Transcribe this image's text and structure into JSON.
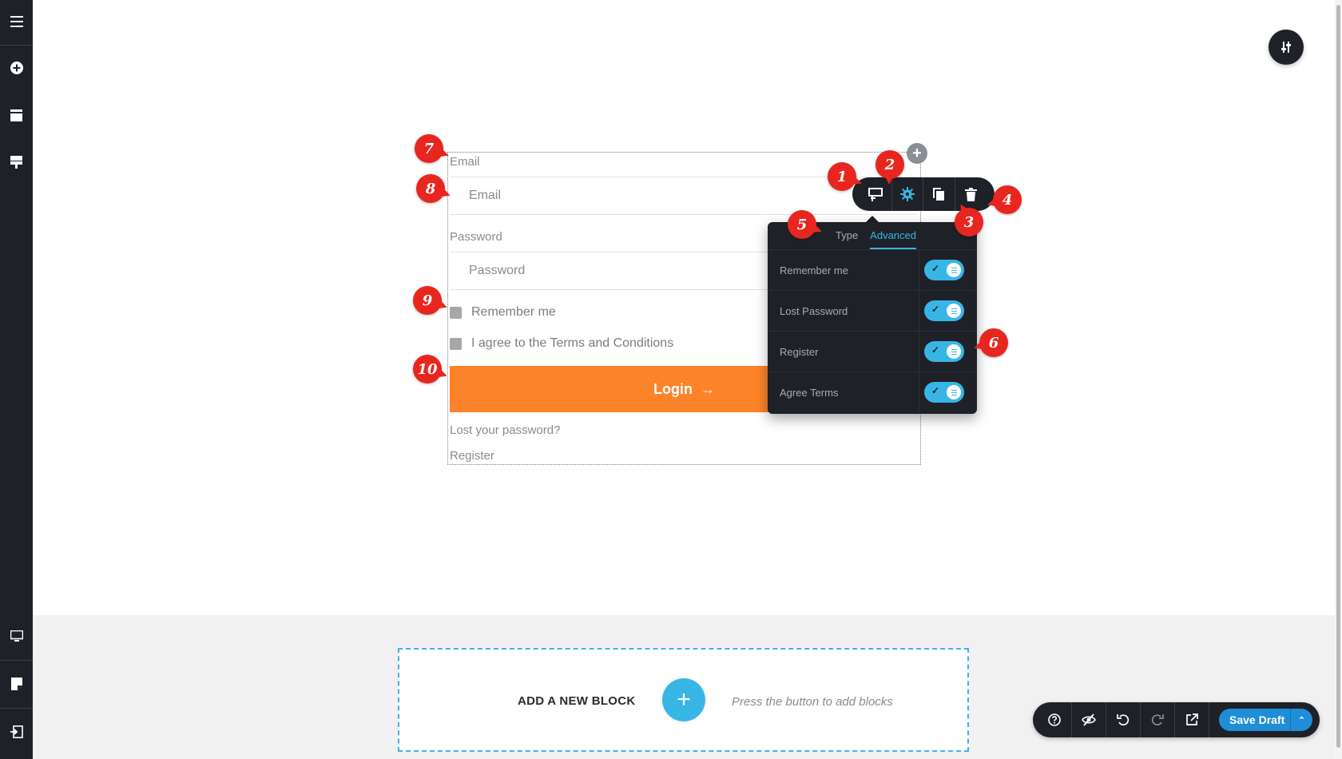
{
  "sidebar": {
    "top_icons": [
      "menu-icon",
      "add-circle-icon",
      "layout-icon",
      "blocks-icon"
    ],
    "bottom_icons": [
      "desktop-icon",
      "page-icon",
      "exit-icon"
    ]
  },
  "form": {
    "email_label": "Email",
    "email_placeholder": "Email",
    "password_label": "Password",
    "password_placeholder": "Password",
    "remember_label": "Remember me",
    "terms_label": "I agree to the Terms and Conditions",
    "login_label": "Login",
    "login_arrow": "→",
    "lost_password": "Lost your password?",
    "register": "Register"
  },
  "toolbar": {
    "buttons": [
      "layout-icon",
      "gear-icon",
      "copy-icon",
      "trash-icon"
    ],
    "add_label": "+"
  },
  "panel": {
    "tabs": [
      {
        "label": "Type",
        "active": false
      },
      {
        "label": "Advanced",
        "active": true
      }
    ],
    "rows": [
      {
        "label": "Remember me",
        "enabled": true
      },
      {
        "label": "Lost Password",
        "enabled": true
      },
      {
        "label": "Register",
        "enabled": true
      },
      {
        "label": "Agree Terms",
        "enabled": true
      }
    ]
  },
  "markers": [
    "1",
    "2",
    "3",
    "4",
    "5",
    "6",
    "7",
    "8",
    "9",
    "10"
  ],
  "add_block": {
    "title": "ADD A NEW BLOCK",
    "plus": "+",
    "hint": "Press the button to add blocks"
  },
  "actionbar": {
    "icons": [
      "help-icon",
      "hide-icon",
      "undo-icon",
      "redo-icon",
      "external-link-icon"
    ],
    "save_label": "Save Draft",
    "save_caret": "⌃"
  },
  "colors": {
    "accent": "#37b6e6",
    "login_button": "#fd832a",
    "marker": "#e8261f",
    "dark_ui": "#1e2127",
    "save_button": "#1f8ed6"
  }
}
